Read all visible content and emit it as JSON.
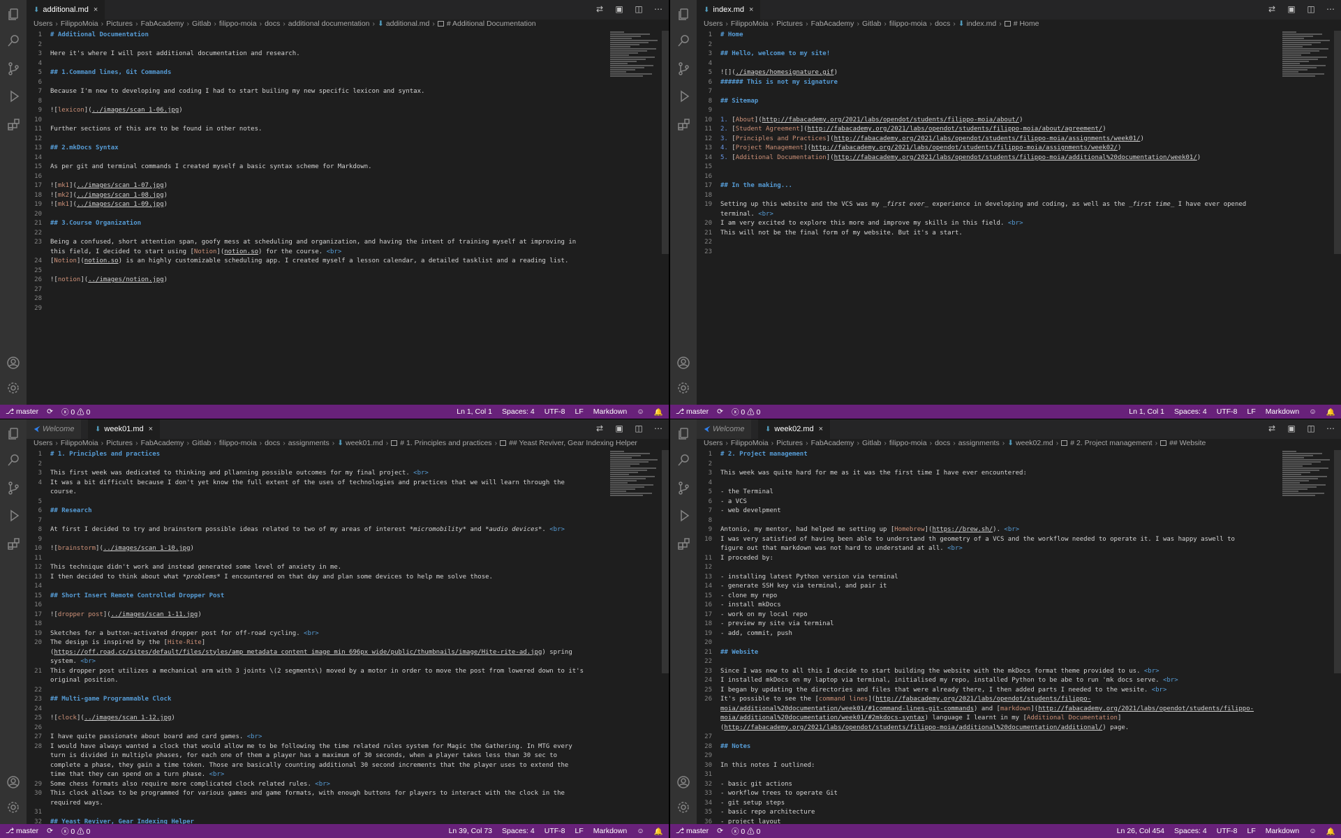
{
  "status_common": {
    "branch": "master",
    "sync_icon": "sync-icon",
    "problems": "ⓧ 0 ⚠ 0",
    "spaces": "Spaces: 4",
    "encoding": "UTF-8",
    "eol": "LF",
    "language": "Markdown"
  },
  "panes": {
    "tl": {
      "tabs": [
        {
          "label": "additional.md",
          "active": true
        }
      ],
      "breadcrumb": [
        "Users",
        "FilippoMoia",
        "Pictures",
        "FabAcademy",
        "Gitlab",
        "filippo-moia",
        "docs",
        "additional documentation",
        "additional.md",
        "# Additional Documentation"
      ],
      "cursor": "Ln 1, Col 1",
      "lines": [
        {
          "n": "1",
          "t": "# Additional Documentation",
          "h": true
        },
        {
          "n": "2",
          "t": ""
        },
        {
          "n": "3",
          "t": "Here it's where I will post additional documentation and research."
        },
        {
          "n": "4",
          "t": ""
        },
        {
          "n": "5",
          "t": "## 1.Command lines, Git Commands",
          "h": true
        },
        {
          "n": "6",
          "t": ""
        },
        {
          "n": "7",
          "t": "Because I'm new to developing and coding I had to start builing my new specific lexicon and syntax."
        },
        {
          "n": "8",
          "t": ""
        },
        {
          "n": "9",
          "t": "![lexicon](../images/scan_1-06.jpg)"
        },
        {
          "n": "10",
          "t": ""
        },
        {
          "n": "11",
          "t": "Further sections of this are to be found in other notes."
        },
        {
          "n": "12",
          "t": ""
        },
        {
          "n": "13",
          "t": "## 2.mkDocs Syntax",
          "h": true
        },
        {
          "n": "14",
          "t": ""
        },
        {
          "n": "15",
          "t": "As per git and terminal commands I created myself a basic syntax scheme for Markdown."
        },
        {
          "n": "16",
          "t": ""
        },
        {
          "n": "17",
          "t": "![mk1](../images/scan_1-07.jpg)"
        },
        {
          "n": "18",
          "t": "![mk2](../images/scan_1-08.jpg)"
        },
        {
          "n": "19",
          "t": "![mk1](../images/scan_1-09.jpg)"
        },
        {
          "n": "20",
          "t": ""
        },
        {
          "n": "21",
          "t": "## 3.Course Organization",
          "h": true
        },
        {
          "n": "22",
          "t": ""
        },
        {
          "n": "23",
          "t": "Being a confused, short attention span, goofy mess at scheduling and organization, and having the intent of training myself at improving in this field, I decided to start using [Notion](notion.so) for the course. <br>"
        },
        {
          "n": "24",
          "t": "[Notion](notion.so) is an highly customizable scheduling app. I created myself a lesson calendar, a detailed tasklist and a reading list."
        },
        {
          "n": "25",
          "t": ""
        },
        {
          "n": "26",
          "t": "![notion](../images/notion.jpg)"
        },
        {
          "n": "27",
          "t": ""
        },
        {
          "n": "28",
          "t": ""
        },
        {
          "n": "29",
          "t": ""
        }
      ]
    },
    "tr": {
      "tabs": [
        {
          "label": "index.md",
          "active": true
        }
      ],
      "breadcrumb": [
        "Users",
        "FilippoMoia",
        "Pictures",
        "FabAcademy",
        "Gitlab",
        "filippo-moia",
        "docs",
        "index.md",
        "# Home"
      ],
      "cursor": "Ln 1, Col 1",
      "lines": [
        {
          "n": "1",
          "t": "# Home",
          "h": true
        },
        {
          "n": "2",
          "t": ""
        },
        {
          "n": "3",
          "t": "## Hello, welcome to my site!",
          "h": true
        },
        {
          "n": "4",
          "t": ""
        },
        {
          "n": "5",
          "t": "![](./images/homesignature.gif)"
        },
        {
          "n": "6",
          "t": "###### This is not my signature",
          "h": true
        },
        {
          "n": "7",
          "t": ""
        },
        {
          "n": "8",
          "t": "## Sitemap",
          "h": true
        },
        {
          "n": "9",
          "t": ""
        },
        {
          "n": "10",
          "t": "1. [About](http://fabacademy.org/2021/labs/opendot/students/filippo-moia/about/)"
        },
        {
          "n": "11",
          "t": "2. [Student Agreement](http://fabacademy.org/2021/labs/opendot/students/filippo-moia/about/agreement/)"
        },
        {
          "n": "12",
          "t": "3. [Principles and Practices](http://fabacademy.org/2021/labs/opendot/students/filippo-moia/assignments/week01/)"
        },
        {
          "n": "13",
          "t": "4. [Project Management](http://fabacademy.org/2021/labs/opendot/students/filippo-moia/assignments/week02/)"
        },
        {
          "n": "14",
          "t": "5. [Additional Documentation](http://fabacademy.org/2021/labs/opendot/students/filippo-moia/additional%20documentation/week01/)"
        },
        {
          "n": "15",
          "t": ""
        },
        {
          "n": "16",
          "t": ""
        },
        {
          "n": "17",
          "t": "## In the making...",
          "h": true
        },
        {
          "n": "18",
          "t": ""
        },
        {
          "n": "19",
          "t": "Setting up this website and the VCS was my _first ever_ experience in developing and coding, as well as the _first time_ I have ever opened terminal. <br>"
        },
        {
          "n": "20",
          "t": "I am very excited to explore this more and improve my skills in this field. <br>"
        },
        {
          "n": "21",
          "t": "This will not be the final form of my website. But it's a start."
        },
        {
          "n": "22",
          "t": ""
        },
        {
          "n": "23",
          "t": ""
        }
      ]
    },
    "bl": {
      "tabs": [
        {
          "label": "Welcome",
          "active": false,
          "welcome": true
        },
        {
          "label": "week01.md",
          "active": true
        }
      ],
      "breadcrumb": [
        "Users",
        "FilippoMoia",
        "Pictures",
        "FabAcademy",
        "Gitlab",
        "filippo-moia",
        "docs",
        "assignments",
        "week01.md",
        "# 1. Principles and practices",
        "## Yeast Reviver, Gear Indexing Helper"
      ],
      "cursor": "Ln 39, Col 73",
      "lines": [
        {
          "n": "1",
          "t": "# 1. Principles and practices",
          "h": true
        },
        {
          "n": "2",
          "t": ""
        },
        {
          "n": "3",
          "t": "This first week was dedicated to thinking and pllanning possible outcomes for my final project. <br>"
        },
        {
          "n": "4",
          "t": "It was a bit difficult because I don't yet know the full extent of the uses of technologies and practices that we will learn through the course."
        },
        {
          "n": "5",
          "t": ""
        },
        {
          "n": "6",
          "t": "## Research",
          "h": true
        },
        {
          "n": "7",
          "t": ""
        },
        {
          "n": "8",
          "t": "At first I decided to try and brainstorm possible ideas related to two of my areas of interest *micromobility* and *audio devices*. <br>"
        },
        {
          "n": "9",
          "t": ""
        },
        {
          "n": "10",
          "t": "![brainstorm](../images/scan_1-10.jpg)"
        },
        {
          "n": "11",
          "t": ""
        },
        {
          "n": "12",
          "t": "This technique didn't work and instead generated some level of anxiety in me."
        },
        {
          "n": "13",
          "t": "I then decided to think about what *problems* I encountered on that day and plan some devices to help me solve those."
        },
        {
          "n": "14",
          "t": ""
        },
        {
          "n": "15",
          "t": "## Short Insert Remote Controlled Dropper Post",
          "h": true
        },
        {
          "n": "16",
          "t": ""
        },
        {
          "n": "17",
          "t": "![dropper post](../images/scan_1-11.jpg)"
        },
        {
          "n": "18",
          "t": ""
        },
        {
          "n": "19",
          "t": "Sketches for a button-activated dropper post for off-road cycling. <br>"
        },
        {
          "n": "20",
          "t": "The design is inspired by the [Hite-Rite](https://off.road.cc/sites/default/files/styles/amp_metadata_content_image_min_696px_wide/public/thumbnails/image/Hite-rite-ad.jpg) spring system. <br>"
        },
        {
          "n": "21",
          "t": "This dropper post utilizes a mechanical arm with 3 joints \\(2 segments\\) moved by a motor in order to move the post from lowered down to it's original position."
        },
        {
          "n": "22",
          "t": ""
        },
        {
          "n": "23",
          "t": "## Multi-game Programmable Clock",
          "h": true
        },
        {
          "n": "24",
          "t": ""
        },
        {
          "n": "25",
          "t": "![clock](../images/scan_1-12.jpg)"
        },
        {
          "n": "26",
          "t": ""
        },
        {
          "n": "27",
          "t": "I have quite passionate about board and card games. <br>"
        },
        {
          "n": "28",
          "t": "I would have always wanted a clock that would allow me to be following the time related rules system for Magic the Gathering. In MTG every turn is divided in multiple phases, for each one of them a player has a maximum of 30 seconds, when a player takes less than 30 sec to complete a phase, they gain a time token. Those are basically counting additional 30 second increments that the player uses to extend the time that they can spend on a turn phase. <br>"
        },
        {
          "n": "29",
          "t": "Some chess formats also require more complicated clock related rules. <br>"
        },
        {
          "n": "30",
          "t": "This clock allows to be programmed for various games and game formats, with enough buttons for players to interact with the clock in the required ways."
        },
        {
          "n": "31",
          "t": ""
        },
        {
          "n": "32",
          "t": "## Yeast Reviver, Gear Indexing Helper",
          "h": true
        },
        {
          "n": "33",
          "t": ""
        }
      ]
    },
    "br": {
      "tabs": [
        {
          "label": "Welcome",
          "active": false,
          "welcome": true
        },
        {
          "label": "week02.md",
          "active": true
        }
      ],
      "breadcrumb": [
        "Users",
        "FilippoMoia",
        "Pictures",
        "FabAcademy",
        "Gitlab",
        "filippo-moia",
        "docs",
        "assignments",
        "week02.md",
        "# 2. Project management",
        "## Website"
      ],
      "cursor": "Ln 26, Col 454",
      "lines": [
        {
          "n": "1",
          "t": "# 2. Project management",
          "h": true
        },
        {
          "n": "2",
          "t": ""
        },
        {
          "n": "3",
          "t": "This week was quite hard for me as it was the first time I have ever encountered:"
        },
        {
          "n": "4",
          "t": ""
        },
        {
          "n": "5",
          "t": "- the Terminal"
        },
        {
          "n": "6",
          "t": "- a VCS"
        },
        {
          "n": "7",
          "t": "- web develpment"
        },
        {
          "n": "8",
          "t": ""
        },
        {
          "n": "9",
          "t": "Antonio, my mentor, had helped me setting up [Homebrew](https://brew.sh/). <br>"
        },
        {
          "n": "10",
          "t": "I was very satisfied of having been able to understand th geometry of a VCS and the workflow needed to operate it. I was happy aswell to figure out that markdown was not hard to understand at all. <br>"
        },
        {
          "n": "11",
          "t": "I proceded by:"
        },
        {
          "n": "12",
          "t": ""
        },
        {
          "n": "13",
          "t": "- installing latest Python version via terminal"
        },
        {
          "n": "14",
          "t": "- generate SSH key via terminal, and pair it"
        },
        {
          "n": "15",
          "t": "- clone my repo"
        },
        {
          "n": "16",
          "t": "- install mkDocs"
        },
        {
          "n": "17",
          "t": "- work on my local repo"
        },
        {
          "n": "18",
          "t": "- preview my site via terminal"
        },
        {
          "n": "19",
          "t": "- add, commit, push"
        },
        {
          "n": "20",
          "t": ""
        },
        {
          "n": "21",
          "t": "## Website",
          "h": true
        },
        {
          "n": "22",
          "t": ""
        },
        {
          "n": "23",
          "t": "Since I was new to all this I decide to start building the website with the mkDocs format theme provided to us. <br>"
        },
        {
          "n": "24",
          "t": "I installed mkDocs on my laptop via terminal, initialised my repo, installed Python to be abe to run 'mk docs serve. <br>"
        },
        {
          "n": "25",
          "t": "I began by updating the directories and files that were already there, I then added parts I needed to the wesite. <br>"
        },
        {
          "n": "26",
          "t": "It's possible to see the [command lines](http://fabacademy.org/2021/labs/opendot/students/filippo-moia/additional%20documentation/week01/#1command-lines-git-commands) and [markdown](http://fabacademy.org/2021/labs/opendot/students/filippo-moia/additional%20documentation/week01/#2mkdocs-syntax) language I learnt in my [Additional Documentation](http://fabacademy.org/2021/labs/opendot/students/filippo-moia/additional%20documentation/additional/) page."
        },
        {
          "n": "27",
          "t": ""
        },
        {
          "n": "28",
          "t": "## Notes",
          "h": true
        },
        {
          "n": "29",
          "t": ""
        },
        {
          "n": "30",
          "t": "In this notes I outlined:"
        },
        {
          "n": "31",
          "t": ""
        },
        {
          "n": "32",
          "t": "- basic git actions"
        },
        {
          "n": "33",
          "t": "- workflow trees to operate Git"
        },
        {
          "n": "34",
          "t": "- git setup steps"
        },
        {
          "n": "35",
          "t": "- basic repo architecture"
        },
        {
          "n": "36",
          "t": "- project layout"
        }
      ]
    }
  }
}
